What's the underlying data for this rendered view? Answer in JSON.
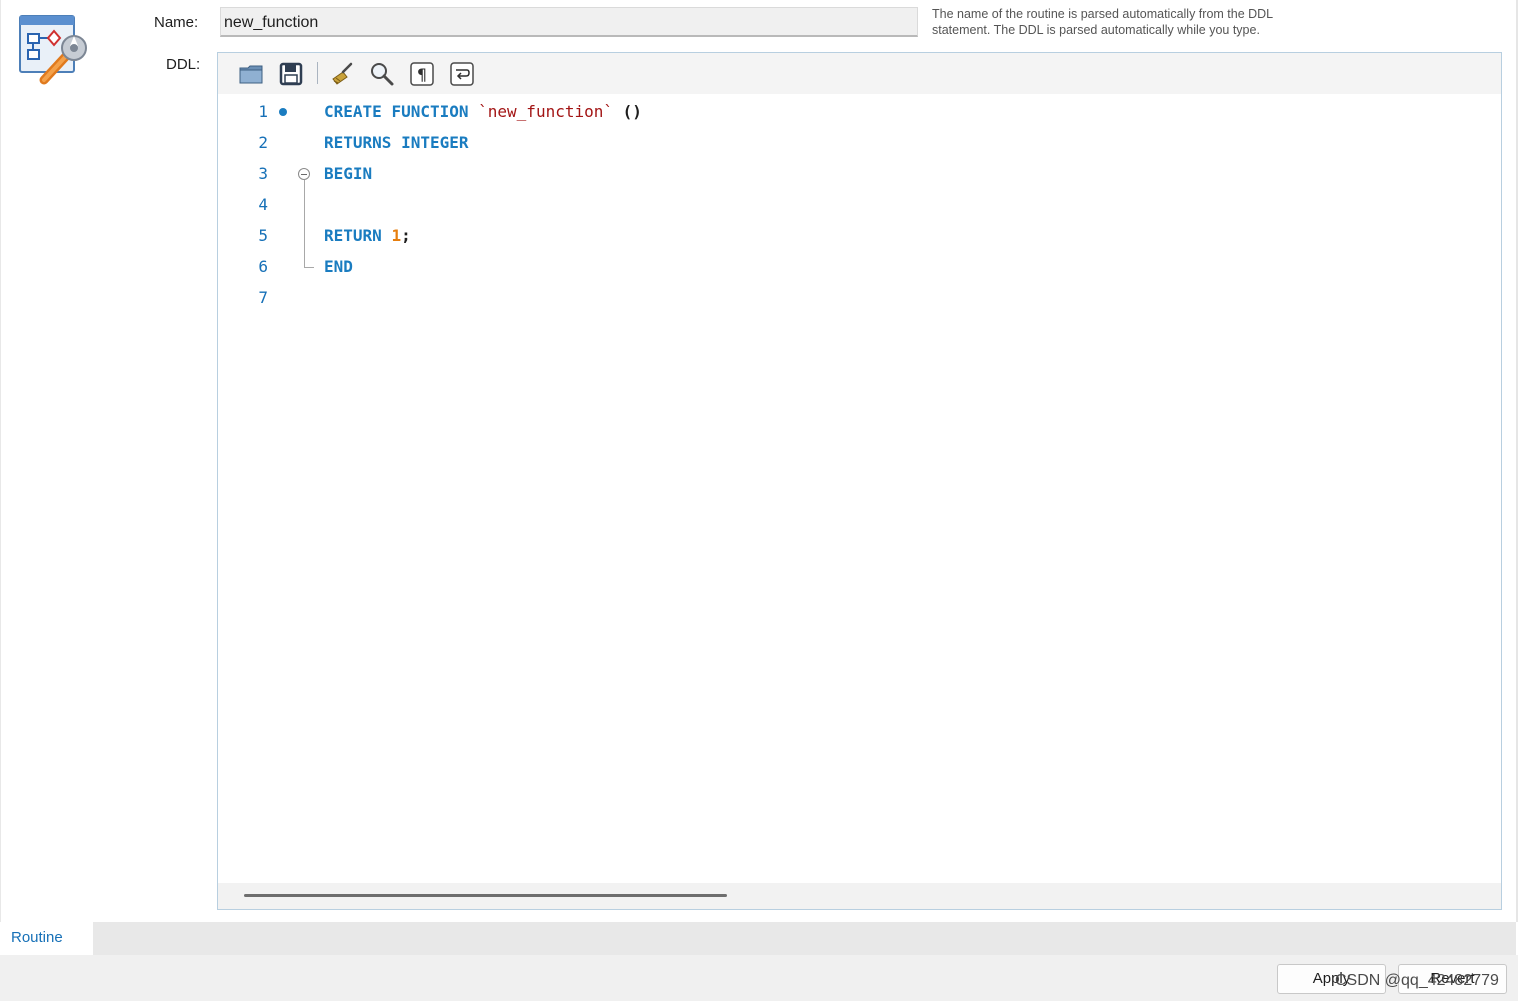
{
  "form": {
    "name_label": "Name:",
    "name_value": "new_function",
    "ddl_label": "DDL:",
    "hint_line1": "The name of the routine is parsed automatically from the DDL",
    "hint_line2": "statement. The DDL is parsed automatically while you type."
  },
  "toolbar": {
    "items": [
      "open-file-icon",
      "save-icon",
      "beautify-icon",
      "find-icon",
      "show-invisibles-icon",
      "word-wrap-icon"
    ]
  },
  "editor": {
    "lines": [
      {
        "num": "1",
        "tokens": [
          {
            "t": "CREATE",
            "c": "kw"
          },
          {
            "t": " ",
            "c": ""
          },
          {
            "t": "FUNCTION",
            "c": "kw"
          },
          {
            "t": " ",
            "c": ""
          },
          {
            "t": "`new_function`",
            "c": "str"
          },
          {
            "t": " ",
            "c": ""
          },
          {
            "t": "()",
            "c": "punc"
          }
        ]
      },
      {
        "num": "2",
        "tokens": [
          {
            "t": "RETURNS",
            "c": "kw"
          },
          {
            "t": " ",
            "c": ""
          },
          {
            "t": "INTEGER",
            "c": "kw"
          }
        ]
      },
      {
        "num": "3",
        "tokens": [
          {
            "t": "BEGIN",
            "c": "kw"
          }
        ]
      },
      {
        "num": "4",
        "tokens": []
      },
      {
        "num": "5",
        "tokens": [
          {
            "t": "RETURN",
            "c": "kw"
          },
          {
            "t": " ",
            "c": ""
          },
          {
            "t": "1",
            "c": "num"
          },
          {
            "t": ";",
            "c": "punc"
          }
        ]
      },
      {
        "num": "6",
        "tokens": [
          {
            "t": "END",
            "c": "kw"
          }
        ]
      },
      {
        "num": "7",
        "tokens": []
      }
    ],
    "colors": {
      "keyword": "#1a7cc0",
      "string": "#a31515",
      "number": "#e67e0e",
      "line_number": "#1670b7"
    }
  },
  "tabs": [
    {
      "label": "Routine",
      "active": true
    }
  ],
  "footer": {
    "apply_label": "Apply",
    "revert_label": "Revert",
    "watermark": "CSDN @qq_42482779"
  }
}
